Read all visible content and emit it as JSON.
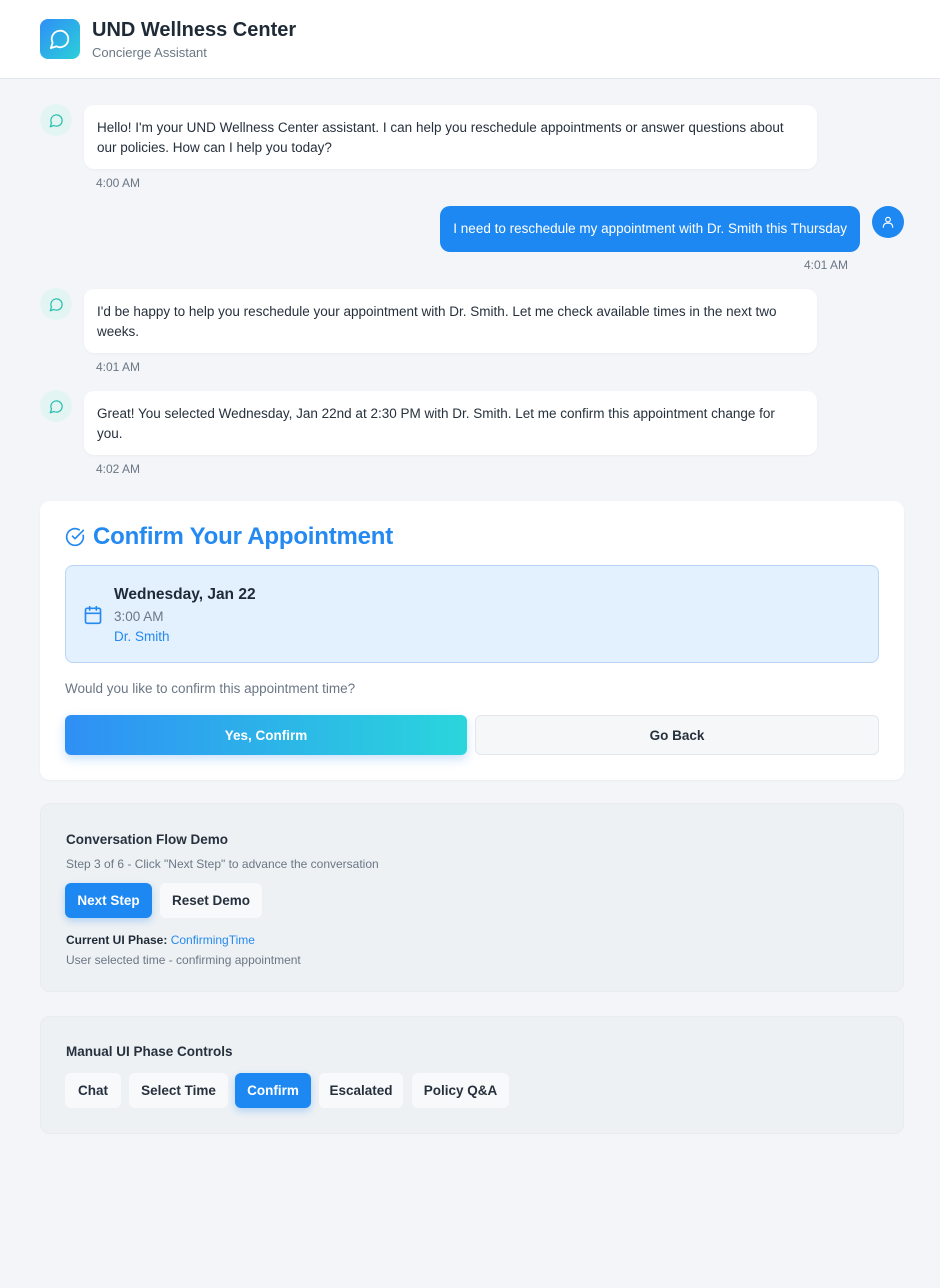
{
  "header": {
    "title": "UND Wellness Center",
    "subtitle": "Concierge Assistant",
    "logo_icon": "chat-bubble-icon"
  },
  "messages": [
    {
      "sender": "bot",
      "text": "Hello! I'm your UND Wellness Center assistant. I can help you reschedule appointments or answer questions about our policies. How can I help you today?",
      "time": "4:00 AM"
    },
    {
      "sender": "user",
      "text": "I need to reschedule my appointment with Dr. Smith this Thursday",
      "time": "4:01 AM"
    },
    {
      "sender": "bot",
      "text": "I'd be happy to help you reschedule your appointment with Dr. Smith. Let me check available times in the next two weeks.",
      "time": "4:01 AM"
    },
    {
      "sender": "bot",
      "text": "Great! You selected Wednesday, Jan 22nd at 2:30 PM with Dr. Smith. Let me confirm this appointment change for you.",
      "time": "4:02 AM"
    }
  ],
  "confirm": {
    "title": "Confirm Your Appointment",
    "date": "Wednesday, Jan 22",
    "time": "3:00 AM",
    "doctor": "Dr. Smith",
    "question": "Would you like to confirm this appointment time?",
    "confirm_label": "Yes, Confirm",
    "back_label": "Go Back"
  },
  "demo": {
    "title": "Conversation Flow Demo",
    "step_text": "Step 3 of 6 - Click \"Next Step\" to advance the conversation",
    "next_label": "Next Step",
    "reset_label": "Reset Demo",
    "phase_label": "Current UI Phase:",
    "phase_value": "ConfirmingTime",
    "phase_desc": "User selected time - confirming appointment"
  },
  "manual": {
    "title": "Manual UI Phase Controls",
    "buttons": [
      {
        "label": "Chat",
        "active": false
      },
      {
        "label": "Select Time",
        "active": false
      },
      {
        "label": "Confirm",
        "active": true
      },
      {
        "label": "Escalated",
        "active": false
      },
      {
        "label": "Policy Q&A",
        "active": false
      }
    ]
  },
  "colors": {
    "accent": "#1e88f2",
    "accent_text": "#2489f0",
    "gradient_end": "#2ad6dc",
    "background": "#f3f5f8"
  }
}
